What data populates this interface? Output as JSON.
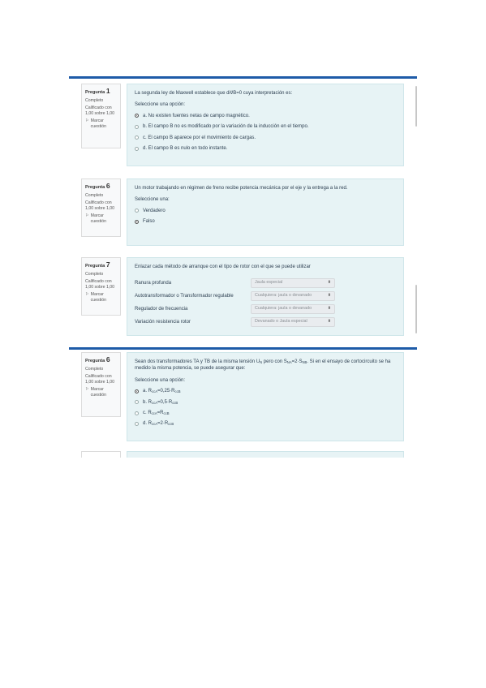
{
  "colors": {
    "accent": "#1e5ba8",
    "content_bg": "#e7f3f5"
  },
  "question1": {
    "label": "Pregunta",
    "number": "1",
    "state": "Completo",
    "grade": "Calificado con 1,00 sobre 1,00",
    "flag_label": "Marcar cuestión",
    "text": "La segunda ley de Maxwell establece que div⃗B=0  cuya interpretación es:",
    "prompt": "Seleccione una opción:",
    "options": [
      "a. No existen fuentes netas de campo magnético.",
      "b. El campo B no es modificado por la variación de la inducción en el tiempo.",
      "c. El campo B aparece por el movimiento de cargas.",
      "d. El campo B es nulo en todo instante."
    ],
    "selected_index": 0
  },
  "question6a": {
    "label": "Pregunta",
    "number": "6",
    "state": "Completo",
    "grade": "Calificado con 1,00 sobre 1,00",
    "flag_label": "Marcar cuestión",
    "text": "Un motor trabajando en régimen de freno recibe potencia mecánica por el eje y la entrega a la red.",
    "prompt": "Seleccione una:",
    "options": [
      "Verdadero",
      "Falso"
    ],
    "selected_index": 1
  },
  "question7": {
    "label": "Pregunta",
    "number": "7",
    "state": "Completo",
    "grade": "Calificado con 1,00 sobre 1,00",
    "flag_label": "Marcar cuestión",
    "text": "Enlazar cada método de arranque con el tipo de rotor con el que se puede utilizar",
    "matches": [
      {
        "label": "Ranura profunda",
        "value": "Jaula especial"
      },
      {
        "label": "Autotransformador o Transformador regulable",
        "value": "Cualquiera: jaula o devanado"
      },
      {
        "label": "Regulador de frecuencia",
        "value": "Cualquiera: jaula o devanado"
      },
      {
        "label": "Variación resistencia rotor",
        "value": "Devanado o Jaula especial"
      }
    ]
  },
  "question6b": {
    "label": "Pregunta",
    "number": "6",
    "state": "Completo",
    "grade": "Calificado con 1,00 sobre 1,00",
    "flag_label": "Marcar cuestión",
    "text_1": "Sean dos transformadores TA y TB de la misma tensión U",
    "text_sub1": "N",
    "text_2": " pero con S",
    "text_sub2": "NA",
    "text_3": "=2·S",
    "text_sub3": "NB",
    "text_4": ". Si en el ensayo de cortocircuito se ha medido la misma potencia, se puede asegurar que:",
    "prompt": "Seleccione una opción:",
    "options": [
      {
        "pre": "a. R",
        "sub": "ccA",
        "mid": "=0,25·R",
        "sub2": "ccB"
      },
      {
        "pre": "b. R",
        "sub": "ccA",
        "mid": "=0,5·R",
        "sub2": "ccB"
      },
      {
        "pre": "c. R",
        "sub": "ccA",
        "mid": "=R",
        "sub2": "ccB"
      },
      {
        "pre": "d. R",
        "sub": "ccA",
        "mid": "=2·R",
        "sub2": "ccB"
      }
    ],
    "selected_index": 0
  }
}
